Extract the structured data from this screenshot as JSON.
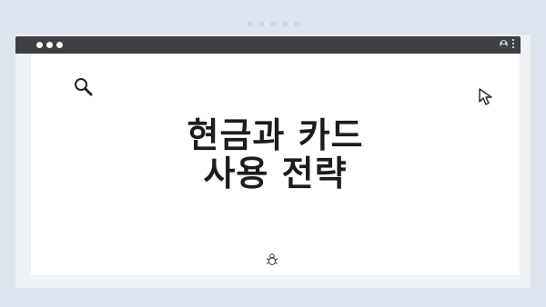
{
  "window": {
    "indicator_dots": 5,
    "traffic_lights": 3
  },
  "content": {
    "headline_line1": "현금과 카드",
    "headline_line2": "사용 전략"
  },
  "icons": {
    "top_left": "search-icon",
    "top_right": "cursor-arrow-icon",
    "bottom_center": "bug-icon",
    "titlebar_right": [
      "account-icon",
      "more-vertical-icon"
    ]
  },
  "colors": {
    "background": "#dde4ee",
    "titlebar": "#3d3f44",
    "window": "#eef1f5",
    "content": "#ffffff",
    "text": "#1c1c1c"
  }
}
